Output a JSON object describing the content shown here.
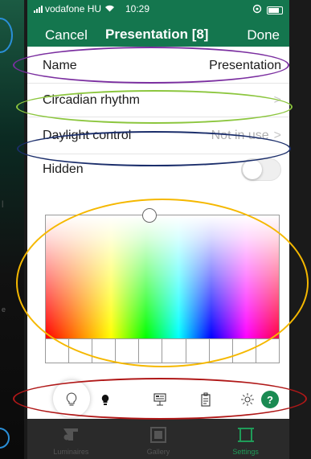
{
  "status_bar": {
    "carrier": "vodafone HU",
    "time": "10:29"
  },
  "nav": {
    "cancel_label": "Cancel",
    "title": "Presentation [8]",
    "done_label": "Done"
  },
  "settings": {
    "name": {
      "label": "Name",
      "value": "Presentation"
    },
    "circadian": {
      "label": "Circadian rhythm"
    },
    "daylight": {
      "label": "Daylight control",
      "value": "Not in use"
    },
    "hidden": {
      "label": "Hidden",
      "on": false
    }
  },
  "color_picker": {
    "swatch_count": 10
  },
  "icon_bar": {
    "icons": [
      "lightbulb-outline-icon",
      "lightbulb-filled-icon",
      "presentation-board-icon",
      "document-icon",
      "sun-icon",
      "help-icon"
    ],
    "help_label": "?"
  },
  "tabs": [
    {
      "label": "Luminaires",
      "icon": "luminaire-icon",
      "active": false
    },
    {
      "label": "Gallery",
      "icon": "gallery-icon",
      "active": false
    },
    {
      "label": "Settings",
      "icon": "settings-icon",
      "active": true
    }
  ],
  "colors": {
    "header": "#14764e",
    "accent": "#1f9b58",
    "tabbar": "#2a2a2a"
  },
  "annotation_colors": [
    "#7b2fa0",
    "#8cc63e",
    "#1b2e6b",
    "#f5b800",
    "#b01818"
  ]
}
